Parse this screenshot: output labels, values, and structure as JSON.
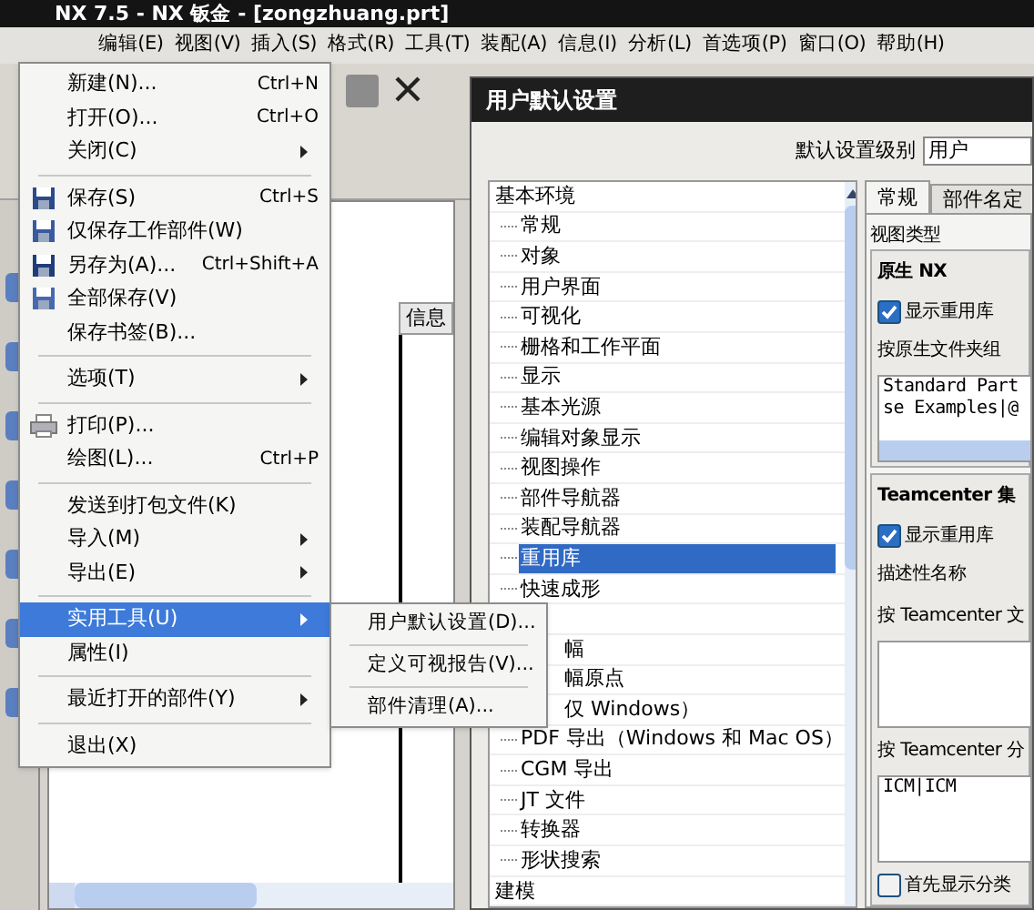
{
  "app": {
    "title": "NX 7.5 - NX 钣金 - [zongzhuang.prt]",
    "menus": [
      "编辑(E)",
      "视图(V)",
      "插入(S)",
      "格式(R)",
      "工具(T)",
      "装配(A)",
      "信息(I)",
      "分析(L)",
      "首选项(P)",
      "窗口(O)",
      "帮助(H)"
    ],
    "column_header": "信息"
  },
  "file_menu": [
    {
      "kind": "item",
      "label": "新建(N)...",
      "shortcut": "Ctrl+N",
      "submenu": false,
      "highlighted": false
    },
    {
      "kind": "item",
      "label": "打开(O)...",
      "shortcut": "Ctrl+O",
      "submenu": false,
      "highlighted": false
    },
    {
      "kind": "item",
      "label": "关闭(C)",
      "submenu": true,
      "highlighted": false
    },
    {
      "kind": "separator"
    },
    {
      "kind": "item",
      "label": "保存(S)",
      "shortcut": "Ctrl+S",
      "submenu": false,
      "highlighted": false
    },
    {
      "kind": "item",
      "label": "仅保存工作部件(W)",
      "submenu": false,
      "highlighted": false
    },
    {
      "kind": "item",
      "label": "另存为(A)...",
      "shortcut": "Ctrl+Shift+A",
      "submenu": false,
      "highlighted": false
    },
    {
      "kind": "item",
      "label": "全部保存(V)",
      "submenu": false,
      "highlighted": false
    },
    {
      "kind": "item",
      "label": "保存书签(B)...",
      "submenu": false,
      "highlighted": false
    },
    {
      "kind": "separator"
    },
    {
      "kind": "item",
      "label": "选项(T)",
      "submenu": true,
      "highlighted": false
    },
    {
      "kind": "separator"
    },
    {
      "kind": "item",
      "label": "打印(P)...",
      "submenu": false,
      "highlighted": false
    },
    {
      "kind": "item",
      "label": "绘图(L)...",
      "shortcut": "Ctrl+P",
      "submenu": false,
      "highlighted": false
    },
    {
      "kind": "separator"
    },
    {
      "kind": "item",
      "label": "发送到打包文件(K)",
      "submenu": false,
      "highlighted": false
    },
    {
      "kind": "item",
      "label": "导入(M)",
      "submenu": true,
      "highlighted": false
    },
    {
      "kind": "item",
      "label": "导出(E)",
      "submenu": true,
      "highlighted": false
    },
    {
      "kind": "separator"
    },
    {
      "kind": "item",
      "label": "实用工具(U)",
      "submenu": true,
      "highlighted": true
    },
    {
      "kind": "item",
      "label": "属性(I)",
      "submenu": false,
      "highlighted": false
    },
    {
      "kind": "separator"
    },
    {
      "kind": "item",
      "label": "最近打开的部件(Y)",
      "submenu": true,
      "highlighted": false
    },
    {
      "kind": "separator"
    },
    {
      "kind": "item",
      "label": "退出(X)",
      "submenu": false,
      "highlighted": false
    }
  ],
  "submenu": [
    {
      "kind": "item",
      "label": "用户默认设置(D)..."
    },
    {
      "kind": "separator"
    },
    {
      "kind": "item",
      "label": "定义可视报告(V)..."
    },
    {
      "kind": "separator"
    },
    {
      "kind": "item",
      "label": "部件清理(A)..."
    }
  ],
  "dialog": {
    "title": "用户默认设置",
    "level_label": "默认设置级别",
    "level_value": "用户",
    "tree": [
      {
        "label": "基本环境",
        "children": [
          {
            "kind": "item",
            "label": "常规",
            "selected": false
          },
          {
            "kind": "item",
            "label": "对象",
            "selected": false
          },
          {
            "kind": "item",
            "label": "用户界面",
            "selected": false
          },
          {
            "kind": "item",
            "label": "可视化",
            "selected": false
          },
          {
            "kind": "item",
            "label": "栅格和工作平面",
            "selected": false
          },
          {
            "kind": "item",
            "label": "显示",
            "selected": false
          },
          {
            "kind": "item",
            "label": "基本光源",
            "selected": false
          },
          {
            "kind": "item",
            "label": "编辑对象显示",
            "selected": false
          },
          {
            "kind": "item",
            "label": "视图操作",
            "selected": false
          },
          {
            "kind": "item",
            "label": "部件导航器",
            "selected": false
          },
          {
            "kind": "item",
            "label": "装配导航器",
            "selected": false
          },
          {
            "kind": "item",
            "label": "重用库",
            "selected": true
          },
          {
            "kind": "item",
            "label": "快速成形",
            "selected": false
          },
          {
            "kind": "covered"
          },
          {
            "kind": "partial",
            "label": "幅",
            "selected": false
          },
          {
            "kind": "partial",
            "label": "幅原点",
            "selected": false
          },
          {
            "kind": "partial",
            "label": "仅 Windows）",
            "selected": false
          },
          {
            "kind": "item",
            "label": "PDF 导出（Windows 和 Mac OS）",
            "selected": false
          },
          {
            "kind": "item",
            "label": "CGM 导出",
            "selected": false
          },
          {
            "kind": "item",
            "label": "JT 文件",
            "selected": false
          },
          {
            "kind": "item",
            "label": "转换器",
            "selected": false
          },
          {
            "kind": "item",
            "label": "形状搜索",
            "selected": false
          }
        ]
      },
      {
        "label": "建模"
      }
    ],
    "tabs": [
      {
        "label": "常规",
        "selected": true
      },
      {
        "label": "部件名定",
        "selected": false
      }
    ],
    "section_label": "视图类型",
    "groups": [
      {
        "title": "原生 NX",
        "rows": [
          {
            "kind": "checkbox",
            "label": "显示重用库",
            "checked": true
          },
          {
            "kind": "label",
            "label": "按原生文件夹组"
          },
          {
            "kind": "textarea",
            "lines": [
              "Standard Part",
              "se Examples|@"
            ],
            "scrollbar": true
          }
        ]
      },
      {
        "title": "Teamcenter 集",
        "rows": [
          {
            "kind": "checkbox",
            "label": "显示重用库",
            "checked": true
          },
          {
            "kind": "label",
            "label": "描述性名称"
          },
          {
            "kind": "label",
            "label": "按 Teamcenter 文"
          },
          {
            "kind": "textarea",
            "lines": [],
            "scrollbar": false
          },
          {
            "kind": "label",
            "label": "按 Teamcenter 分"
          },
          {
            "kind": "textarea",
            "lines": [
              "ICM|ICM"
            ],
            "scrollbar": false
          },
          {
            "kind": "checkbox",
            "label": "首先显示分类",
            "checked": false
          }
        ]
      }
    ]
  }
}
